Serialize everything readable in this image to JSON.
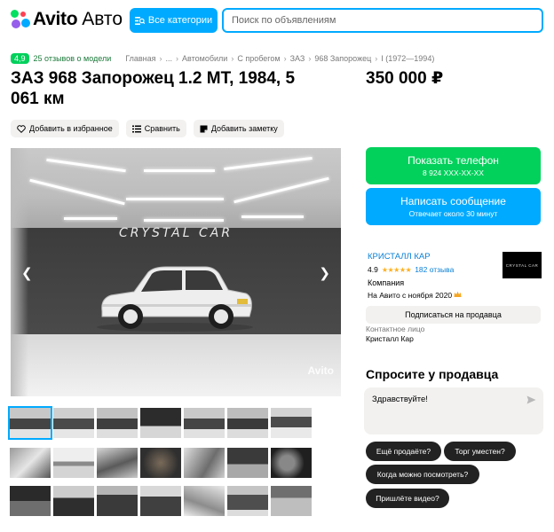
{
  "header": {
    "logo_main": "Avito",
    "logo_sub": "Авто",
    "categories_label": "Все категории",
    "search_placeholder": "Поиск по объявлениям"
  },
  "breadcrumbs": {
    "rating": "4,9",
    "reviews": "25 отзывов о модели",
    "items": [
      "Главная",
      "...",
      "Автомобили",
      "С пробегом",
      "ЗАЗ",
      "968 Запорожец",
      "I (1972—1994)"
    ]
  },
  "listing": {
    "title": "ЗАЗ 968 Запорожец 1.2 MT, 1984, 5 061 км",
    "price": "350 000 ₽"
  },
  "actions": {
    "favorite": "Добавить в избранное",
    "compare": "Сравнить",
    "note": "Добавить заметку"
  },
  "gallery": {
    "wall_text": "CRYSTAL CAR",
    "watermark": "Avito",
    "prev_icon": "chevron-left-icon",
    "next_icon": "chevron-right-icon"
  },
  "contact": {
    "show_phone": "Показать телефон",
    "phone_masked": "8 924 XXX-XX-XX",
    "write": "Написать сообщение",
    "reply_time": "Отвечает около 30 минут"
  },
  "seller": {
    "name": "КРИСТАЛЛ КАР",
    "rating": "4.9",
    "stars": "★★★★★",
    "reviews": "182 отзыва",
    "type": "Компания",
    "since": "На Авито с ноября 2020",
    "logo_text": "CRYSTAL CAR",
    "subscribe": "Подписаться на продавца",
    "contact_type": "Контактное лицо",
    "contact_name": "Кристалл Кар"
  },
  "ask": {
    "title": "Спросите у продавца",
    "message": "Здравствуйте!",
    "quick_questions": [
      "Ещё продаёте?",
      "Торг уместен?",
      "Когда можно посмотреть?",
      "Пришлёте видео?"
    ]
  },
  "colors": {
    "green": "#02d15c",
    "blue": "#00aaff",
    "link": "#0a80d6",
    "chip": "#222222"
  }
}
